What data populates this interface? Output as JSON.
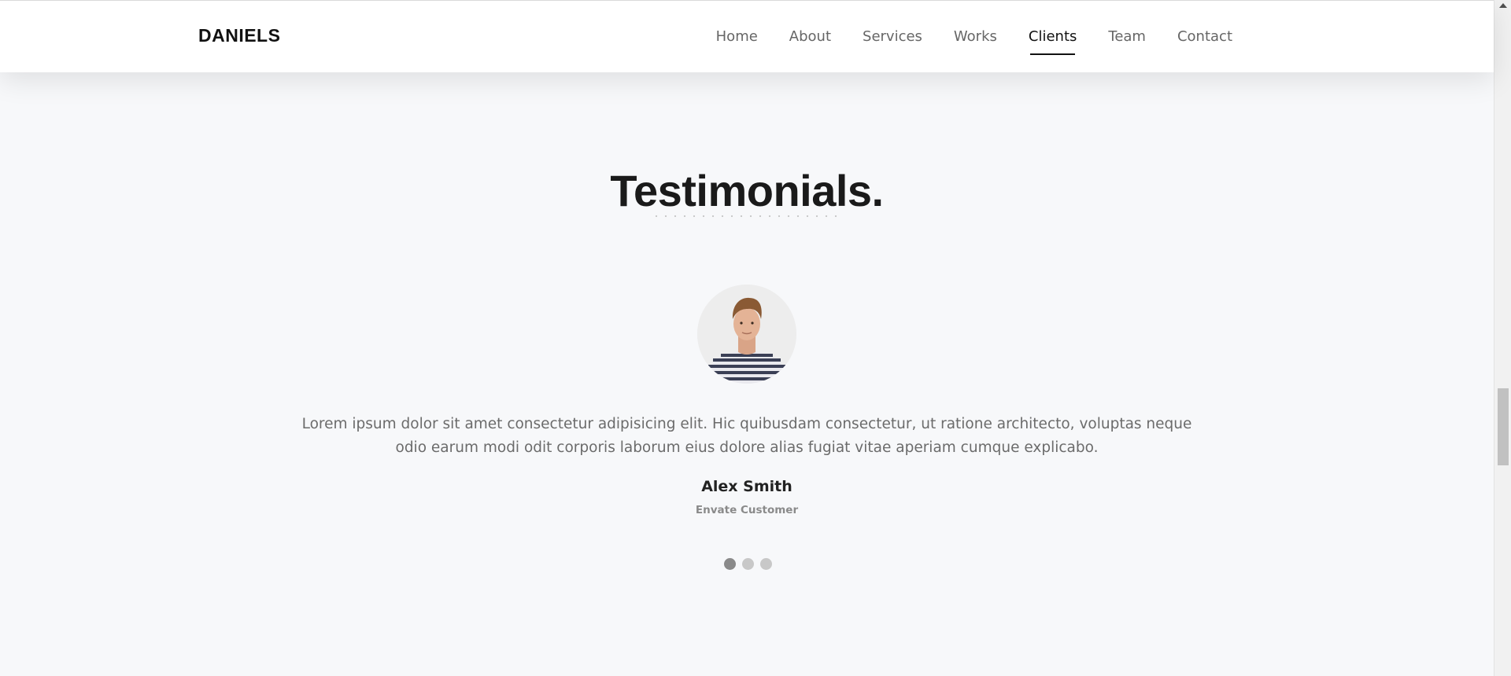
{
  "header": {
    "brand": "DANIELS",
    "nav": [
      {
        "label": "Home",
        "active": false
      },
      {
        "label": "About",
        "active": false
      },
      {
        "label": "Services",
        "active": false
      },
      {
        "label": "Works",
        "active": false
      },
      {
        "label": "Clients",
        "active": true
      },
      {
        "label": "Team",
        "active": false
      },
      {
        "label": "Contact",
        "active": false
      }
    ]
  },
  "testimonials": {
    "title": "Testimonials.",
    "quote": "Lorem ipsum dolor sit amet consectetur adipisicing elit. Hic quibusdam consectetur, ut ratione architecto, voluptas neque odio earum modi odit corporis laborum eius dolore alias fugiat vitae aperiam cumque explicabo.",
    "name": "Alex Smith",
    "role": "Envate Customer",
    "avatar_icon": "person-avatar-photo",
    "slides": 3,
    "active_slide": 1
  },
  "colors": {
    "background": "#f7f8fa",
    "text_dark": "#1a1a1a",
    "text_muted": "#6b6b6b",
    "accent": "#111111"
  }
}
